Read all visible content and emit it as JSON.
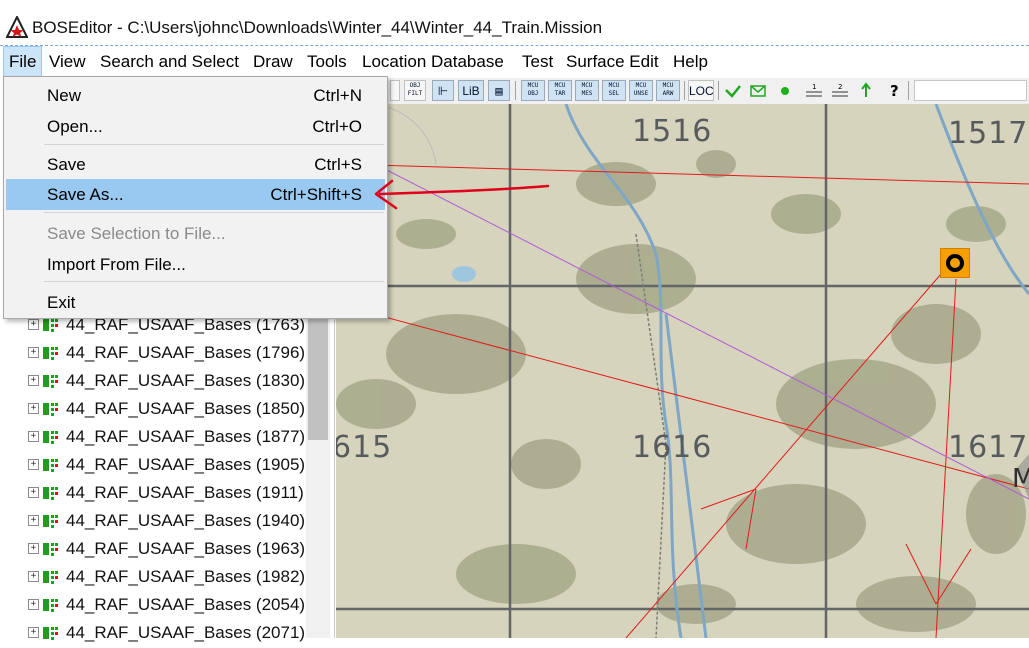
{
  "window": {
    "title": "BOSEditor - C:\\Users\\johnc\\Downloads\\Winter_44\\Winter_44_Train.Mission"
  },
  "menubar": {
    "items": [
      "File",
      "View",
      "Search and Select",
      "Draw",
      "Tools",
      "Location Database",
      "Test",
      "Surface Edit",
      "Help"
    ]
  },
  "file_menu": {
    "new": {
      "label": "New",
      "shortcut": "Ctrl+N"
    },
    "open": {
      "label": "Open...",
      "shortcut": "Ctrl+O"
    },
    "save": {
      "label": "Save",
      "shortcut": "Ctrl+S"
    },
    "save_as": {
      "label": "Save As...",
      "shortcut": "Ctrl+Shift+S"
    },
    "save_selection": {
      "label": "Save Selection to File..."
    },
    "import": {
      "label": "Import From File..."
    },
    "exit": {
      "label": "Exit"
    }
  },
  "toolbar": {
    "buttons": [
      {
        "top": "OBJ",
        "bottom": "FILT"
      },
      {
        "big": "LiB"
      },
      {
        "top": "MCU",
        "bottom": "OBJ"
      },
      {
        "top": "MCU",
        "bottom": "TAR"
      },
      {
        "top": "MCU",
        "bottom": "MES"
      },
      {
        "top": "MCU",
        "bottom": "SEL"
      },
      {
        "top": "MCU",
        "bottom": "UNSE"
      },
      {
        "top": "MCU",
        "bottom": "ARW"
      },
      {
        "big": "LOC"
      }
    ]
  },
  "map": {
    "grid_labels": [
      "1516",
      "1517",
      "1616",
      "1617",
      "615"
    ],
    "partial_label": "M"
  },
  "tree": {
    "rows": [
      "44_RAF_USAAF_Bases (1763)",
      "44_RAF_USAAF_Bases (1796)",
      "44_RAF_USAAF_Bases (1830)",
      "44_RAF_USAAF_Bases (1850)",
      "44_RAF_USAAF_Bases (1877)",
      "44_RAF_USAAF_Bases (1905)",
      "44_RAF_USAAF_Bases (1911)",
      "44_RAF_USAAF_Bases (1940)",
      "44_RAF_USAAF_Bases (1963)",
      "44_RAF_USAAF_Bases (1982)",
      "44_RAF_USAAF_Bases (2054)",
      "44_RAF_USAAF_Bases (2071)"
    ]
  },
  "colors": {
    "menu_highlight": "#99c9f0",
    "annotation_arrow": "#e0001b",
    "map_background": "#d6d4bc",
    "map_marker": "#f5a000"
  }
}
